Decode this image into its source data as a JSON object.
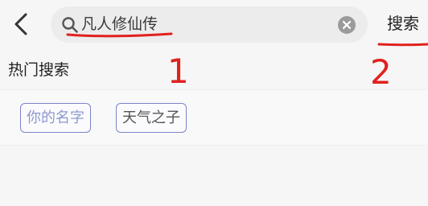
{
  "search": {
    "query": "凡人修仙传",
    "button_label": "搜索"
  },
  "hot": {
    "title": "热门搜索",
    "tags": [
      "你的名字",
      "天气之子"
    ]
  },
  "annotations": {
    "label1": "1",
    "label2": "2",
    "color": "#e0211e"
  },
  "icons": {
    "back": "chevron-left-icon",
    "search": "search-icon",
    "clear": "clear-icon"
  }
}
